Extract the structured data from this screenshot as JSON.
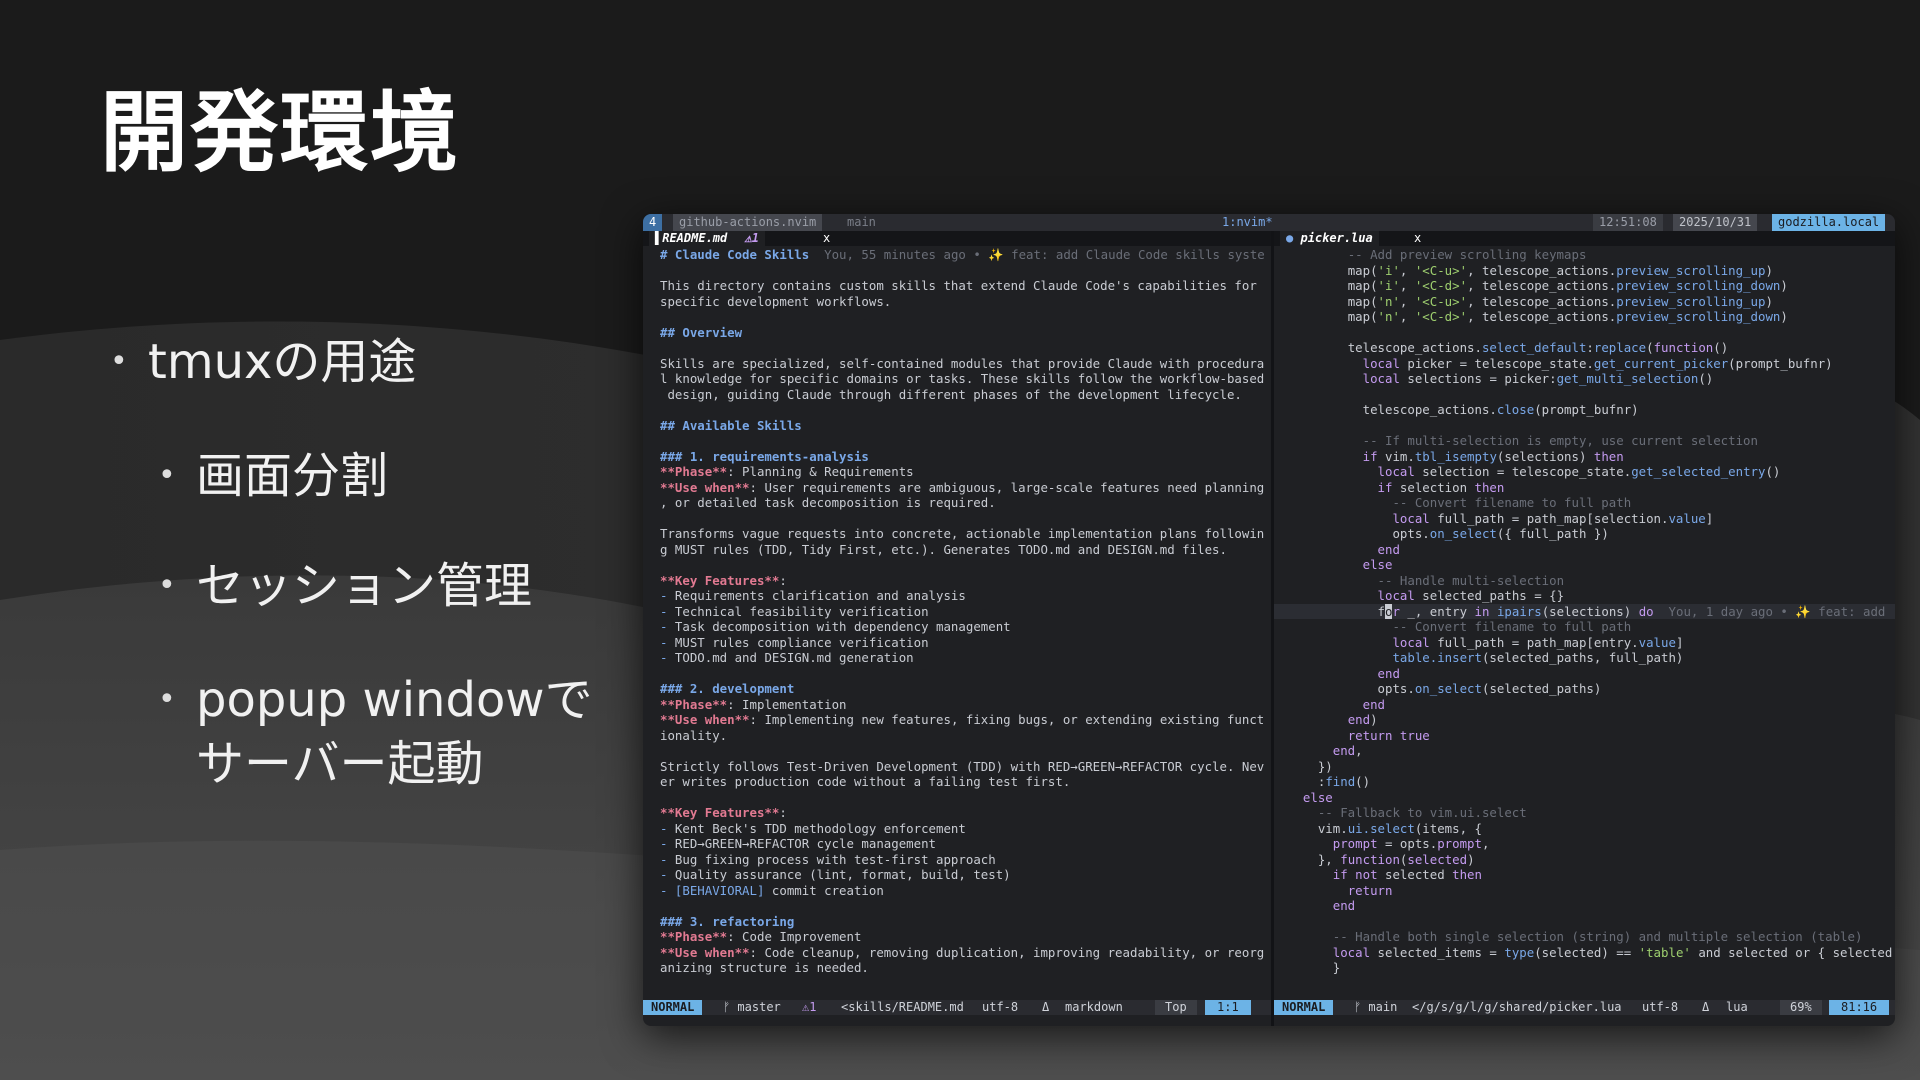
{
  "slide": {
    "title": "開発環境",
    "bullets": [
      {
        "text": "tmuxの用途"
      },
      {
        "text": "画面分割"
      },
      {
        "text": "セッション管理"
      },
      {
        "text": "popup windowで"
      },
      {
        "text": "サーバー起動"
      }
    ]
  },
  "tmux": {
    "window_index": "4",
    "session": "github-actions.nvim",
    "branch": "main",
    "window": "1:nvim*",
    "time": "12:51:08",
    "date": "2025/10/31",
    "host": "godzilla.local"
  },
  "left_pane": {
    "tab_name": "README.md",
    "tab_warn": "⚠1",
    "tab_close": "x",
    "lines": [
      {
        "t": "# Claude Code Skills",
        "c": "h",
        "vt": "  You, 55 minutes ago • ✨ feat: add Claude Code skills syste"
      },
      {
        "t": ""
      },
      {
        "t": "This directory contains custom skills that extend Claude Code's capabilities for"
      },
      {
        "t": "specific development workflows."
      },
      {
        "t": ""
      },
      {
        "t": "## Overview",
        "c": "h"
      },
      {
        "t": ""
      },
      {
        "t": "Skills are specialized, self-contained modules that provide Claude with procedura"
      },
      {
        "t": "l knowledge for specific domains or tasks. These skills follow the workflow-based"
      },
      {
        "t": " design, guiding Claude through different phases of the development lifecycle."
      },
      {
        "t": ""
      },
      {
        "t": "## Available Skills",
        "c": "h"
      },
      {
        "t": ""
      },
      {
        "t": "### 1. requirements-analysis",
        "c": "h"
      },
      {
        "k": "**Phase**",
        "t": ": Planning & Requirements"
      },
      {
        "k": "**Use when**",
        "t": ": User requirements are ambiguous, large-scale features need planning"
      },
      {
        "t": ", or detailed task decomposition is required."
      },
      {
        "t": ""
      },
      {
        "t": "Transforms vague requests into concrete, actionable implementation plans followin"
      },
      {
        "t": "g MUST rules (TDD, Tidy First, etc.). Generates TODO.md and DESIGN.md files."
      },
      {
        "t": ""
      },
      {
        "k": "**Key Features**",
        "t": ":"
      },
      {
        "d": "- ",
        "t": "Requirements clarification and analysis"
      },
      {
        "d": "- ",
        "t": "Technical feasibility verification"
      },
      {
        "d": "- ",
        "t": "Task decomposition with dependency management"
      },
      {
        "d": "- ",
        "t": "MUST rules compliance verification"
      },
      {
        "d": "- ",
        "t": "TODO.md and DESIGN.md generation"
      },
      {
        "t": ""
      },
      {
        "t": "### 2. development",
        "c": "h"
      },
      {
        "k": "**Phase**",
        "t": ": Implementation"
      },
      {
        "k": "**Use when**",
        "t": ": Implementing new features, fixing bugs, or extending existing funct"
      },
      {
        "t": "ionality."
      },
      {
        "t": ""
      },
      {
        "t": "Strictly follows Test-Driven Development (TDD) with RED→GREEN→REFACTOR cycle. Nev"
      },
      {
        "t": "er writes production code without a failing test first."
      },
      {
        "t": ""
      },
      {
        "k": "**Key Features**",
        "t": ":"
      },
      {
        "d": "- ",
        "t": "Kent Beck's TDD methodology enforcement"
      },
      {
        "d": "- ",
        "t": "RED→GREEN→REFACTOR cycle management"
      },
      {
        "d": "- ",
        "t": "Bug fixing process with test-first approach"
      },
      {
        "d": "- ",
        "t": "Quality assurance (lint, format, build, test)"
      },
      {
        "d": "- ",
        "l": "[BEHAVIORAL]",
        "t": " commit creation"
      },
      {
        "t": ""
      },
      {
        "t": "### 3. refactoring",
        "c": "h"
      },
      {
        "k": "**Phase**",
        "t": ": Code Improvement"
      },
      {
        "k": "**Use when**",
        "t": ": Code cleanup, removing duplication, improving readability, or reorg"
      },
      {
        "t": "anizing structure is needed."
      }
    ],
    "status": {
      "mode": "NORMAL",
      "branch": "ᚠ master",
      "warn": "⚠1",
      "path": "<skills/README.md",
      "encoding": "utf-8",
      "os": "Δ",
      "filetype": "markdown",
      "scroll": "Top",
      "pos": "1:1"
    }
  },
  "right_pane": {
    "tab_name": "picker.lua",
    "tab_close": "x",
    "lines": [
      {
        "i": "        ",
        "s": [
          [
            "cm",
            "-- Add preview scrolling keymaps"
          ]
        ]
      },
      {
        "i": "        ",
        "s": [
          [
            "",
            "map("
          ],
          [
            "st",
            "'i'"
          ],
          [
            "",
            ", "
          ],
          [
            "st",
            "'<C-u>'"
          ],
          [
            "",
            ", telescope_actions."
          ],
          [
            "fn",
            "preview_scrolling_up"
          ],
          [
            "",
            ")"
          ]
        ]
      },
      {
        "i": "        ",
        "s": [
          [
            "",
            "map("
          ],
          [
            "st",
            "'i'"
          ],
          [
            "",
            ", "
          ],
          [
            "st",
            "'<C-d>'"
          ],
          [
            "",
            ", telescope_actions."
          ],
          [
            "fn",
            "preview_scrolling_down"
          ],
          [
            "",
            ")"
          ]
        ]
      },
      {
        "i": "        ",
        "s": [
          [
            "",
            "map("
          ],
          [
            "st",
            "'n'"
          ],
          [
            "",
            ", "
          ],
          [
            "st",
            "'<C-u>'"
          ],
          [
            "",
            ", telescope_actions."
          ],
          [
            "fn",
            "preview_scrolling_up"
          ],
          [
            "",
            ")"
          ]
        ]
      },
      {
        "i": "        ",
        "s": [
          [
            "",
            "map("
          ],
          [
            "st",
            "'n'"
          ],
          [
            "",
            ", "
          ],
          [
            "st",
            "'<C-d>'"
          ],
          [
            "",
            ", telescope_actions."
          ],
          [
            "fn",
            "preview_scrolling_down"
          ],
          [
            "",
            ")"
          ]
        ]
      },
      {
        "i": "",
        "s": []
      },
      {
        "i": "        ",
        "s": [
          [
            "",
            "telescope_actions."
          ],
          [
            "fn",
            "select_default"
          ],
          [
            "",
            ":"
          ],
          [
            "fn",
            "replace"
          ],
          [
            "",
            "("
          ],
          [
            "kw",
            "function"
          ],
          [
            "",
            "()"
          ]
        ]
      },
      {
        "i": "          ",
        "s": [
          [
            "kw",
            "local"
          ],
          [
            "",
            " picker = telescope_state."
          ],
          [
            "fn",
            "get_current_picker"
          ],
          [
            "",
            "(prompt_bufnr)"
          ]
        ]
      },
      {
        "i": "          ",
        "s": [
          [
            "kw",
            "local"
          ],
          [
            "",
            " selections = picker:"
          ],
          [
            "fn",
            "get_multi_selection"
          ],
          [
            "",
            "()"
          ]
        ]
      },
      {
        "i": "",
        "s": []
      },
      {
        "i": "          ",
        "s": [
          [
            "",
            "telescope_actions."
          ],
          [
            "fn",
            "close"
          ],
          [
            "",
            "(prompt_bufnr)"
          ]
        ]
      },
      {
        "i": "",
        "s": []
      },
      {
        "i": "          ",
        "s": [
          [
            "cm",
            "-- If multi-selection is empty, use current selection"
          ]
        ]
      },
      {
        "i": "          ",
        "s": [
          [
            "kw",
            "if"
          ],
          [
            "",
            " vim."
          ],
          [
            "fn",
            "tbl_isempty"
          ],
          [
            "",
            "(selections) "
          ],
          [
            "kw",
            "then"
          ]
        ]
      },
      {
        "i": "            ",
        "s": [
          [
            "kw",
            "local"
          ],
          [
            "",
            " selection = telescope_state."
          ],
          [
            "fn",
            "get_selected_entry"
          ],
          [
            "",
            "()"
          ]
        ]
      },
      {
        "i": "            ",
        "s": [
          [
            "kw",
            "if"
          ],
          [
            "",
            " selection "
          ],
          [
            "kw",
            "then"
          ]
        ]
      },
      {
        "i": "              ",
        "s": [
          [
            "cm",
            "-- Convert filename to full path"
          ]
        ]
      },
      {
        "i": "              ",
        "s": [
          [
            "kw",
            "local"
          ],
          [
            "",
            " full_path = path_map[selection."
          ],
          [
            "fn",
            "value"
          ],
          [
            "",
            "]"
          ]
        ]
      },
      {
        "i": "              ",
        "s": [
          [
            "",
            "opts."
          ],
          [
            "fn",
            "on_select"
          ],
          [
            "",
            "({ full_path })"
          ]
        ]
      },
      {
        "i": "            ",
        "s": [
          [
            "kw",
            "end"
          ]
        ]
      },
      {
        "i": "          ",
        "s": [
          [
            "kw",
            "else"
          ]
        ]
      },
      {
        "i": "            ",
        "s": [
          [
            "cm",
            "-- Handle multi-selection"
          ]
        ]
      },
      {
        "i": "            ",
        "s": [
          [
            "kw",
            "local"
          ],
          [
            "",
            " selected_paths = {}"
          ]
        ]
      },
      {
        "i": "            ",
        "cur": true,
        "s": [
          [
            "",
            "f"
          ],
          [
            "cursor",
            "o"
          ],
          [
            "kw",
            "r"
          ],
          [
            "",
            " _, entry "
          ],
          [
            "kw",
            "in"
          ],
          [
            "",
            " "
          ],
          [
            "fn",
            "ipairs"
          ],
          [
            "",
            "(selections) "
          ],
          [
            "kw",
            "do"
          ],
          [
            "vt",
            "  You, 1 day ago • ✨ feat: add"
          ]
        ]
      },
      {
        "i": "              ",
        "s": [
          [
            "cm",
            "-- Convert filename to full path"
          ]
        ]
      },
      {
        "i": "              ",
        "s": [
          [
            "kw",
            "local"
          ],
          [
            "",
            " full_path = path_map[entry."
          ],
          [
            "fn",
            "value"
          ],
          [
            "",
            "]"
          ]
        ]
      },
      {
        "i": "              ",
        "s": [
          [
            "fn",
            "table.insert"
          ],
          [
            "",
            "(selected_paths, full_path)"
          ]
        ]
      },
      {
        "i": "            ",
        "s": [
          [
            "kw",
            "end"
          ]
        ]
      },
      {
        "i": "            ",
        "s": [
          [
            "",
            "opts."
          ],
          [
            "fn",
            "on_select"
          ],
          [
            "",
            "(selected_paths)"
          ]
        ]
      },
      {
        "i": "          ",
        "s": [
          [
            "kw",
            "end"
          ]
        ]
      },
      {
        "i": "        ",
        "s": [
          [
            "kw",
            "end"
          ],
          [
            "",
            ")"
          ]
        ]
      },
      {
        "i": "        ",
        "s": [
          [
            "kw",
            "return"
          ],
          [
            "",
            " "
          ],
          [
            "kw",
            "true"
          ]
        ]
      },
      {
        "i": "      ",
        "s": [
          [
            "kw",
            "end"
          ],
          [
            "",
            ","
          ]
        ]
      },
      {
        "i": "    ",
        "s": [
          [
            "",
            "})"
          ]
        ]
      },
      {
        "i": "    ",
        "s": [
          [
            "",
            ":"
          ],
          [
            "fn",
            "find"
          ],
          [
            "",
            "()"
          ]
        ]
      },
      {
        "i": "  ",
        "s": [
          [
            "kw",
            "else"
          ]
        ]
      },
      {
        "i": "    ",
        "s": [
          [
            "cm",
            "-- Fallback to vim.ui.select"
          ]
        ]
      },
      {
        "i": "    ",
        "s": [
          [
            "",
            "vim."
          ],
          [
            "fn",
            "ui.select"
          ],
          [
            "",
            "(items, {"
          ]
        ]
      },
      {
        "i": "      ",
        "s": [
          [
            "kw",
            "prompt"
          ],
          [
            "",
            " = opts."
          ],
          [
            "kw",
            "prompt"
          ],
          [
            "",
            ","
          ]
        ]
      },
      {
        "i": "    ",
        "s": [
          [
            "",
            "}, "
          ],
          [
            "kw",
            "function"
          ],
          [
            "",
            "("
          ],
          [
            "kw",
            "selected"
          ],
          [
            "",
            ")"
          ]
        ]
      },
      {
        "i": "      ",
        "s": [
          [
            "kw",
            "if not"
          ],
          [
            "",
            " selected "
          ],
          [
            "kw",
            "then"
          ]
        ]
      },
      {
        "i": "        ",
        "s": [
          [
            "kw",
            "return"
          ]
        ]
      },
      {
        "i": "      ",
        "s": [
          [
            "kw",
            "end"
          ]
        ]
      },
      {
        "i": "",
        "s": []
      },
      {
        "i": "      ",
        "s": [
          [
            "cm",
            "-- Handle both single selection (string) and multiple selection (table)"
          ]
        ]
      },
      {
        "i": "      ",
        "s": [
          [
            "kw",
            "local"
          ],
          [
            "",
            " selected_items = "
          ],
          [
            "fn",
            "type"
          ],
          [
            "",
            "(selected) == "
          ],
          [
            "st",
            "'table'"
          ],
          [
            "",
            " and selected or { selected"
          ]
        ]
      },
      {
        "i": "      ",
        "s": [
          [
            "",
            "}"
          ]
        ]
      }
    ],
    "status": {
      "mode": "NORMAL",
      "branch": "ᚠ main",
      "path": "</g/s/g/l/g/shared/picker.lua",
      "encoding": "utf-8",
      "os": "Δ",
      "filetype": "lua",
      "scroll": "69%",
      "pos": "81:16"
    }
  }
}
